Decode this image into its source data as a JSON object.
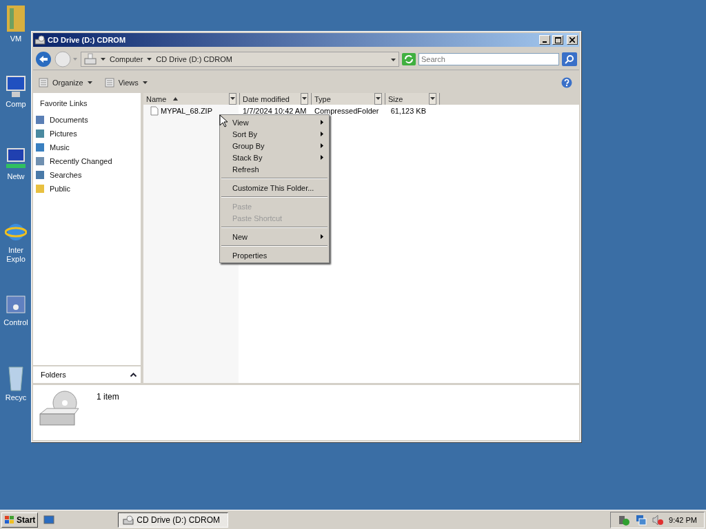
{
  "desktop_icons": [
    {
      "label": "VM",
      "kind": "folder"
    },
    {
      "label": "Comp",
      "kind": "computer"
    },
    {
      "label": "Netw",
      "kind": "network"
    },
    {
      "label": "Inter Explo",
      "kind": "browser"
    },
    {
      "label": "Control",
      "kind": "control"
    },
    {
      "label": "Recyc",
      "kind": "bin"
    }
  ],
  "window": {
    "title": "CD Drive (D:) CDROM",
    "address": [
      "Computer",
      "CD Drive (D:) CDROM"
    ],
    "search": {
      "placeholder": "Search"
    }
  },
  "toolbar": [
    {
      "label": "Organize"
    },
    {
      "label": "Views"
    }
  ],
  "nav": {
    "heading": "Favorite Links",
    "items": [
      {
        "label": "Documents"
      },
      {
        "label": "Pictures"
      },
      {
        "label": "Music"
      },
      {
        "label": "Recently Changed"
      },
      {
        "label": "Searches"
      },
      {
        "label": "Public"
      }
    ],
    "folders": "Folders"
  },
  "table": {
    "columns": [
      {
        "label": "Name",
        "sorted": true
      },
      {
        "label": "Date modified",
        "sorted": false
      },
      {
        "label": "Type",
        "sorted": false
      },
      {
        "label": "Size",
        "sorted": false
      }
    ],
    "rows": [
      {
        "cells": [
          "MYPAL_68.ZIP",
          "1/7/2024 10:42 AM",
          "CompressedFolder",
          "61,123 KB"
        ]
      }
    ]
  },
  "context_menu": [
    {
      "kind": "item",
      "label": "View",
      "submenu": true,
      "disabled": false
    },
    {
      "kind": "item",
      "label": "Sort By",
      "submenu": true,
      "disabled": false
    },
    {
      "kind": "item",
      "label": "Group By",
      "submenu": true,
      "disabled": false
    },
    {
      "kind": "item",
      "label": "Stack By",
      "submenu": true,
      "disabled": false
    },
    {
      "kind": "item",
      "label": "Refresh",
      "submenu": false,
      "disabled": false
    },
    {
      "kind": "separator"
    },
    {
      "kind": "item",
      "label": "Customize This Folder...",
      "submenu": false,
      "disabled": false
    },
    {
      "kind": "separator"
    },
    {
      "kind": "item",
      "label": "Paste",
      "submenu": false,
      "disabled": true
    },
    {
      "kind": "item",
      "label": "Paste Shortcut",
      "submenu": false,
      "disabled": true
    },
    {
      "kind": "separator"
    },
    {
      "kind": "item",
      "label": "New",
      "submenu": true,
      "disabled": false
    },
    {
      "kind": "separator"
    },
    {
      "kind": "item",
      "label": "Properties",
      "submenu": false,
      "disabled": false
    }
  ],
  "details": {
    "text": "1 item"
  },
  "taskbar": {
    "start": "Start",
    "tasks": [
      {
        "label": "CD Drive (D:) CDROM",
        "selected": true
      }
    ],
    "clock": "9:42 PM"
  }
}
